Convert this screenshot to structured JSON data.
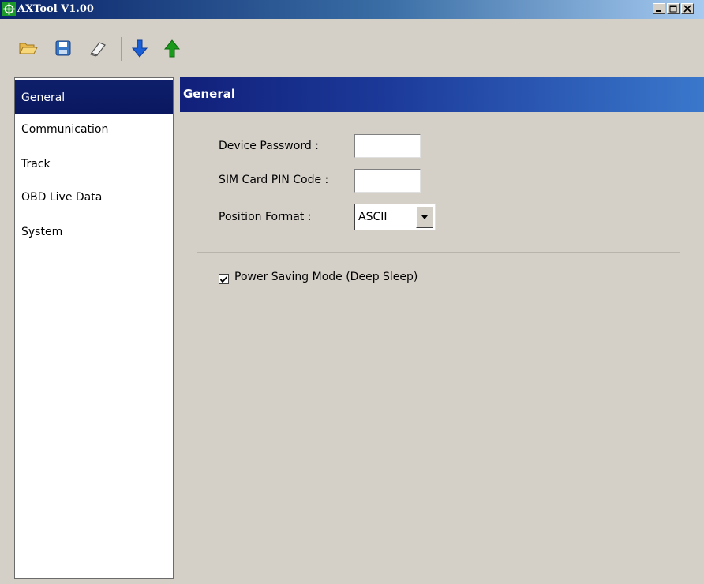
{
  "window": {
    "title": "AXTool V1.00",
    "icons": {
      "app": "crosshair-icon",
      "minimize": "minimize-icon",
      "maximize": "maximize-icon",
      "close": "close-icon"
    }
  },
  "toolbar": {
    "buttons": [
      {
        "icon": "open-folder-icon"
      },
      {
        "icon": "save-icon"
      },
      {
        "icon": "erase-icon"
      },
      {
        "icon": "download-arrow-icon"
      },
      {
        "icon": "upload-arrow-icon"
      }
    ]
  },
  "nav": {
    "items": [
      {
        "label": "General",
        "selected": true
      },
      {
        "label": "Communication"
      },
      {
        "label": "Track"
      },
      {
        "label": "OBD Live Data"
      },
      {
        "label": "System"
      }
    ]
  },
  "panel": {
    "header": "General",
    "device_password": {
      "label": "Device Password :",
      "value": ""
    },
    "sim_pin": {
      "label": "SIM Card PIN Code :",
      "value": ""
    },
    "position_format": {
      "label": "Position Format :",
      "value": "ASCII"
    },
    "power_saving": {
      "label": "Power Saving Mode (Deep Sleep)",
      "checked": true
    }
  },
  "colors": {
    "window_bg": "#d4d0c8",
    "nav_selected": "#0e1f6a",
    "download_arrow": "#1a5fd6",
    "upload_arrow": "#1a9a1a"
  }
}
